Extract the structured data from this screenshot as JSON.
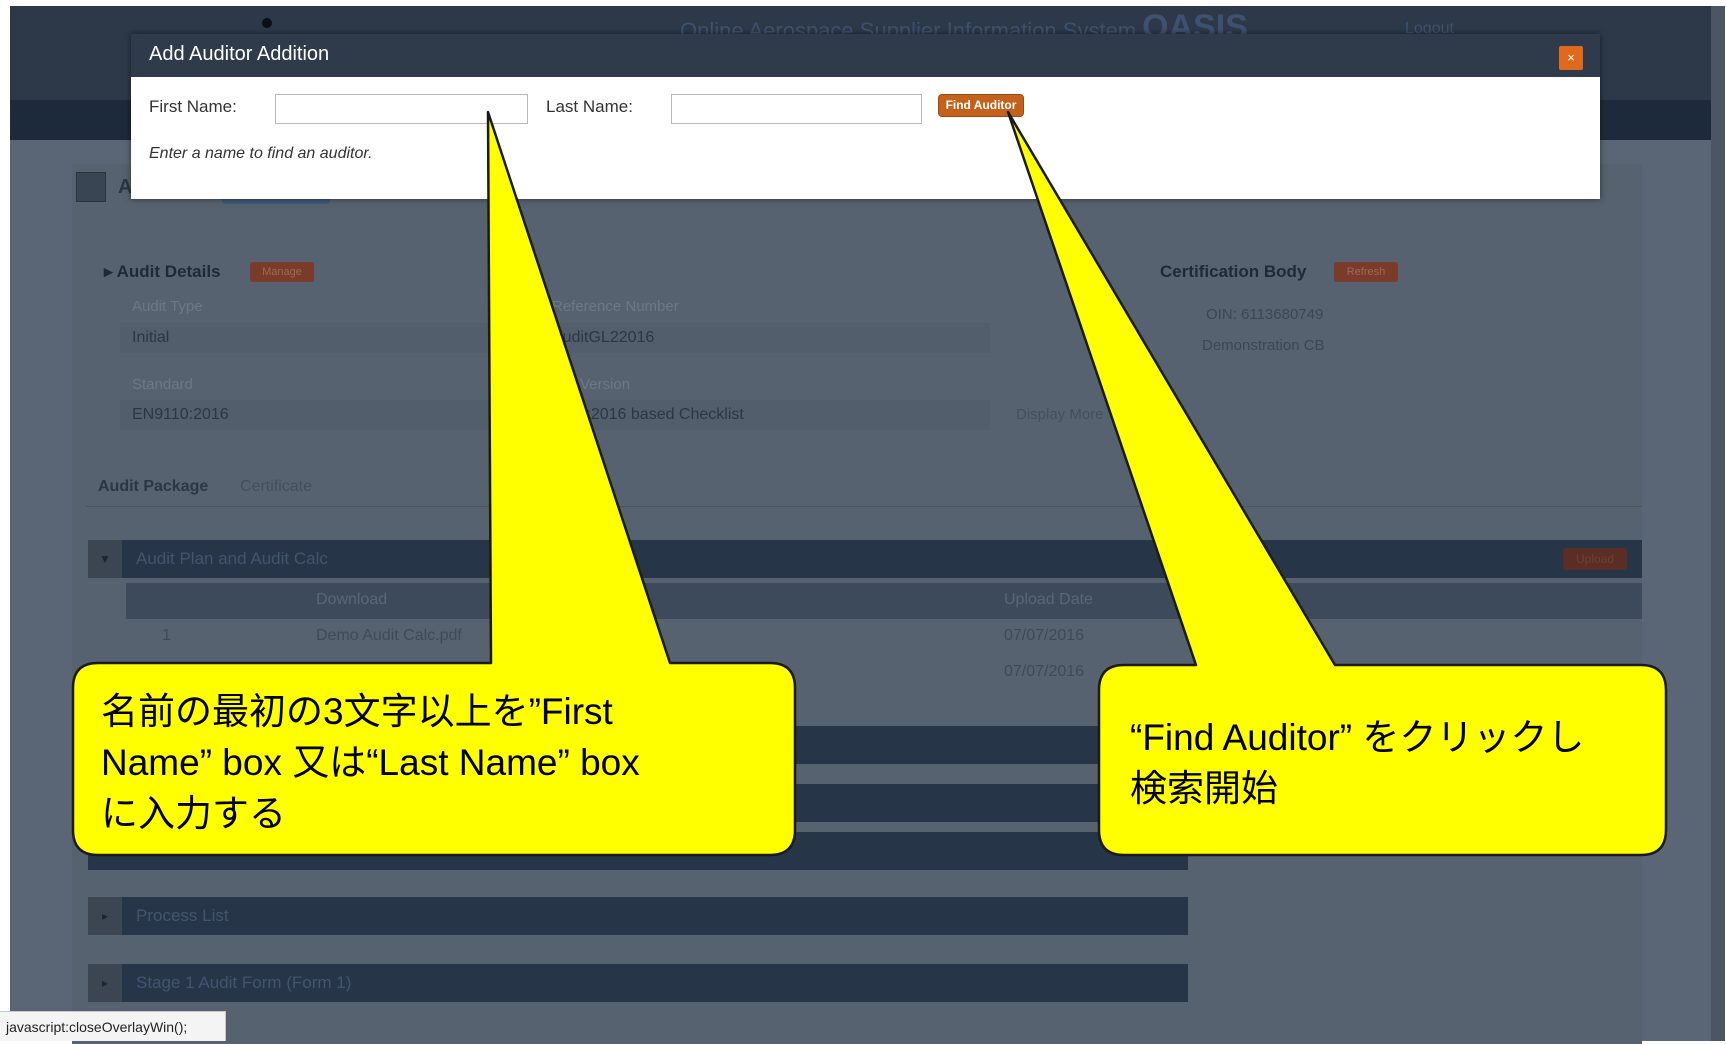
{
  "app": {
    "title_prefix": "Online Aerospace Supplier Information System",
    "title_brand": "OASIS",
    "user_label": "Logout"
  },
  "background": {
    "page_title": "Audit",
    "audit_details": {
      "heading": "Audit Details",
      "manage_button": "Manage",
      "audit_type_label": "Audit Type",
      "audit_type_value": "Initial",
      "reference_label": "Reference Number",
      "reference_value": "AuditGL22016",
      "standard_label": "Standard",
      "standard_value": "EN9110:2016",
      "version_label": "Version",
      "version_value": "9110:2016 based Checklist",
      "display_more": "Display More"
    },
    "certification_body": {
      "heading": "Certification Body",
      "refresh_button": "Refresh",
      "oin": "OIN: 6113680749",
      "name": "Demonstration CB"
    },
    "tabs": [
      "Audit Package",
      "Certificate"
    ],
    "audit_plan": {
      "label": "Audit Plan and Audit Calc",
      "upload_button": "Upload",
      "columns": [
        "Download",
        "Upload Date"
      ],
      "rows": [
        {
          "num": "1",
          "file": "Demo Audit Calc.pdf",
          "date": "07/07/2016"
        },
        {
          "num": "",
          "file": "",
          "date": "07/07/2016"
        }
      ]
    },
    "sections": [
      "Process List",
      "Stage 1 Audit Form (Form 1)"
    ]
  },
  "dialog": {
    "title": "Add Auditor Addition",
    "close_glyph": "×",
    "first_name_label": "First Name:",
    "first_name_value": "",
    "last_name_label": "Last Name:",
    "last_name_value": "",
    "find_button": "Find Auditor",
    "hint": "Enter a name to find an auditor."
  },
  "callouts": {
    "left": [
      "名前の最初の3文字以上を”First",
      "Name” box 又は“Last Name” box",
      "に入力する"
    ],
    "right": [
      "“Find Auditor” をクリックし",
      "検索開始"
    ]
  },
  "status_bar": "javascript:closeOverlayWin();",
  "colors": {
    "callout_fill": "#ffff00",
    "dialog_header": "#2f3b4b",
    "find_button": "#c4621c",
    "close_button": "#e06a1c"
  }
}
